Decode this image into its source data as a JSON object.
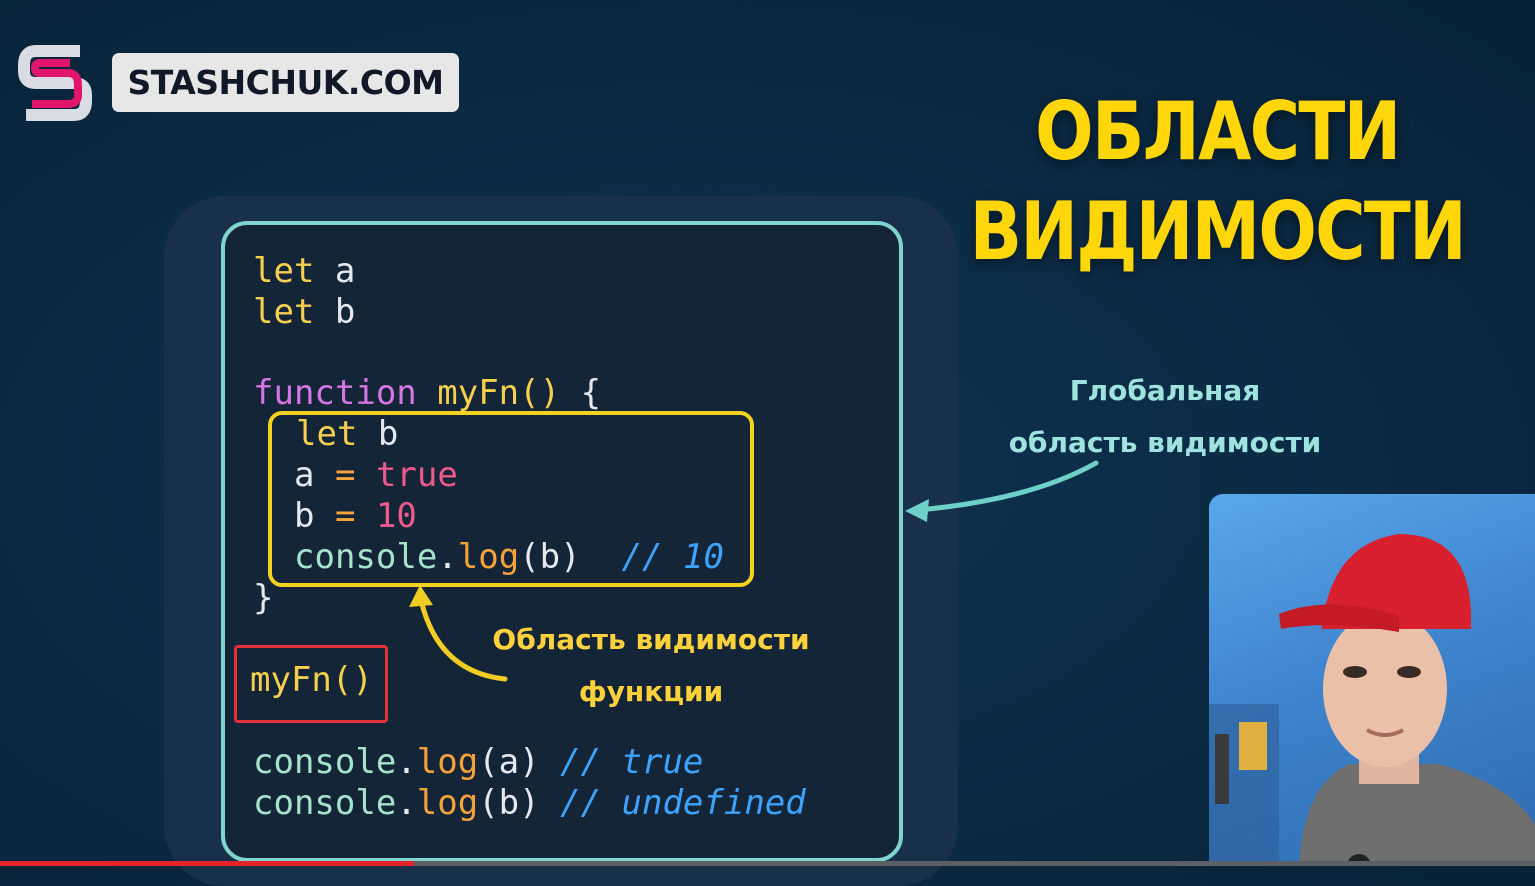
{
  "brand": {
    "name": "STASHCHUK.COM",
    "logo_icon": "stashchuk-s-logo-icon"
  },
  "title": {
    "line1": "ОБЛАСТИ",
    "line2": "ВИДИМОСТИ"
  },
  "code": {
    "line1": {
      "kw": "let",
      "name": "a"
    },
    "line2": {
      "kw": "let",
      "name": "b"
    },
    "line3": {
      "kw": "function",
      "name": "myFn",
      "parens": "()",
      "brace": "{"
    },
    "inner1": {
      "kw": "let",
      "name": "b"
    },
    "inner2": {
      "name": "a",
      "op": "=",
      "value": "true"
    },
    "inner3": {
      "name": "b",
      "op": "=",
      "value": "10"
    },
    "inner4": {
      "obj": "console",
      "dot": ".",
      "method": "log",
      "args": "(b)",
      "comment": "// 10"
    },
    "close": "}",
    "call": "myFn()",
    "log1": {
      "obj": "console",
      "dot": ".",
      "method": "log",
      "args": "(a)",
      "comment": "// true"
    },
    "log2": {
      "obj": "console",
      "dot": ".",
      "method": "log",
      "args": "(b)",
      "comment": "// undefined"
    }
  },
  "labels": {
    "global_line1": "Глобальная",
    "global_line2": "область видимости",
    "func_line1": "Область видимости",
    "func_line2": "функции"
  },
  "colors": {
    "title": "#ffd60a",
    "global_border": "#7fd4cf",
    "function_border": "#f5d21f",
    "call_border": "#e3323a"
  },
  "video": {
    "progress": 0.27
  }
}
